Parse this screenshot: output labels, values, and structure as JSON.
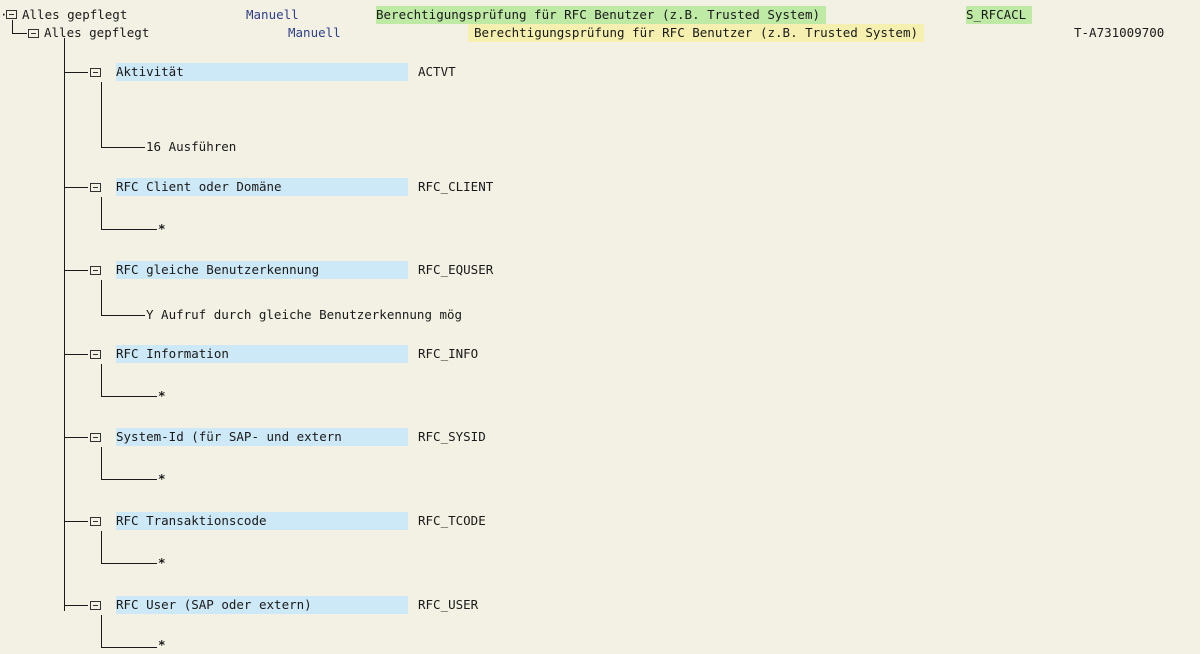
{
  "root": {
    "status": "Alles gepflegt",
    "mode": "Manuell",
    "text": "Berechtigungsprüfung für RFC Benutzer (z.B. Trusted System)",
    "object": "S_RFCACL"
  },
  "child": {
    "status": "Alles gepflegt",
    "mode": "Manuell",
    "text": "Berechtigungsprüfung für RFC Benutzer (z.B. Trusted System)",
    "object": "T-A731009700"
  },
  "fields": [
    {
      "label": "Aktivität",
      "field": "ACTVT",
      "value": "16  Ausführen"
    },
    {
      "label": "RFC Client oder Domäne",
      "field": "RFC_CLIENT",
      "value": "*"
    },
    {
      "label": "RFC gleiche Benutzerkennung",
      "field": "RFC_EQUSER",
      "value": "Y Aufruf durch gleiche Benutzerkennung mög"
    },
    {
      "label": "RFC Information",
      "field": "RFC_INFO",
      "value": "*"
    },
    {
      "label": "System-Id (für SAP- und extern",
      "field": "RFC_SYSID",
      "value": "*"
    },
    {
      "label": "RFC Transaktionscode",
      "field": "RFC_TCODE",
      "value": "*"
    },
    {
      "label": "RFC User (SAP oder extern)",
      "field": "RFC_USER",
      "value": "*"
    }
  ]
}
